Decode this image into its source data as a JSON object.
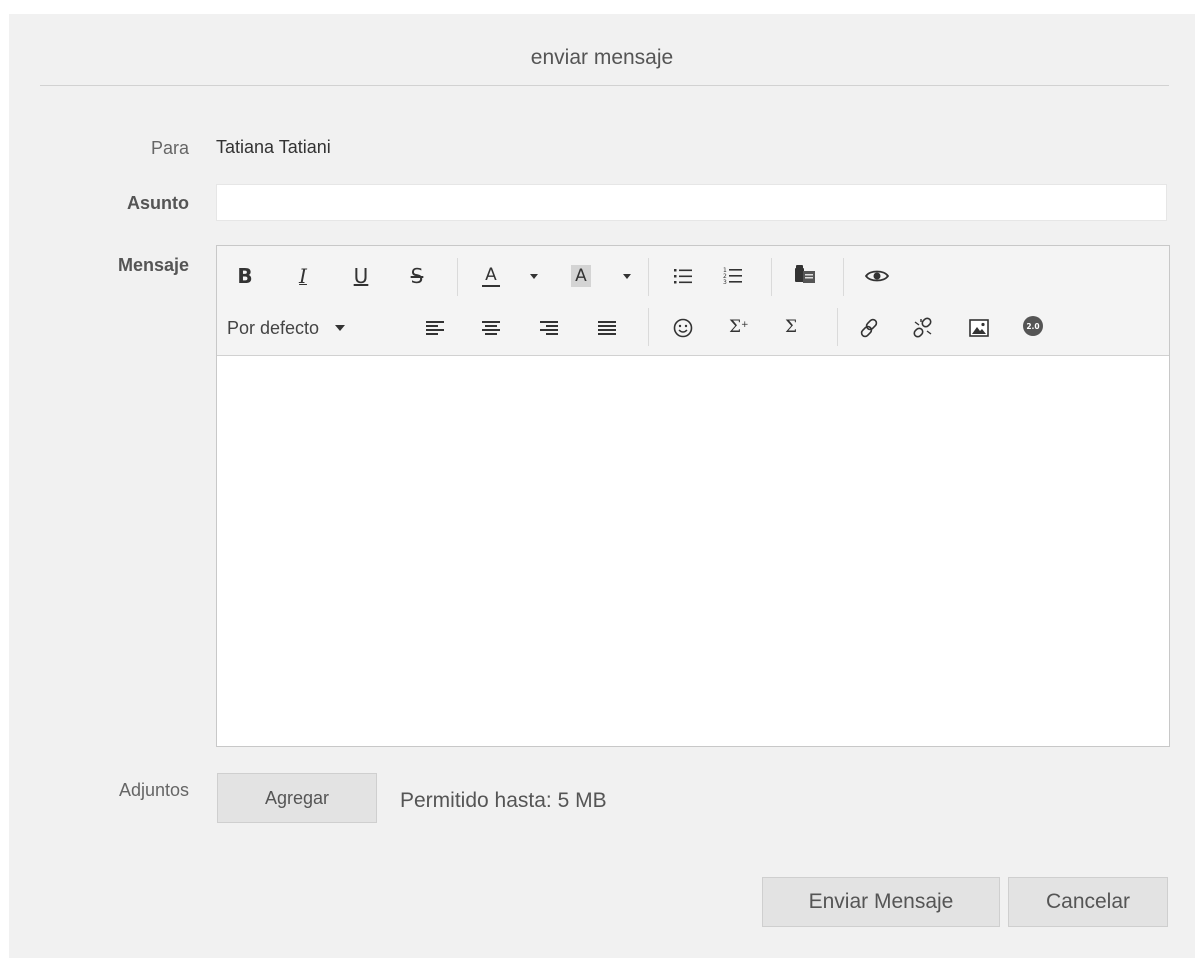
{
  "dialog": {
    "title": "enviar mensaje"
  },
  "form": {
    "to_label": "Para",
    "to_value": "Tatiana Tatiani",
    "subject_label": "Asunto",
    "subject_value": "",
    "message_label": "Mensaje",
    "attachments_label": "Adjuntos"
  },
  "toolbar": {
    "row1": [
      {
        "name": "bold-icon",
        "glyph": "B"
      },
      {
        "name": "italic-icon",
        "glyph": "I"
      },
      {
        "name": "underline-icon",
        "glyph": "U"
      },
      {
        "name": "strikethrough-icon",
        "glyph": "S"
      },
      {
        "name": "text-color-icon",
        "glyph": "A"
      },
      {
        "name": "background-color-icon",
        "glyph": "A"
      },
      {
        "name": "bulleted-list-icon"
      },
      {
        "name": "numbered-list-icon"
      },
      {
        "name": "paste-from-word-icon"
      },
      {
        "name": "preview-icon"
      }
    ],
    "row2": [
      {
        "name": "align-left-icon"
      },
      {
        "name": "align-center-icon"
      },
      {
        "name": "align-right-icon"
      },
      {
        "name": "justify-icon"
      },
      {
        "name": "emoji-icon"
      },
      {
        "name": "sum-plus-icon"
      },
      {
        "name": "sigma-icon"
      },
      {
        "name": "link-icon"
      },
      {
        "name": "unlink-icon"
      },
      {
        "name": "image-icon"
      },
      {
        "name": "web20-badge-icon"
      }
    ],
    "font_size_value": "Por defecto",
    "web20_badge_text": "2.0"
  },
  "attachments": {
    "add_label": "Agregar",
    "limit_text": "Permitido hasta: 5 MB"
  },
  "actions": {
    "send_label": "Enviar Mensaje",
    "cancel_label": "Cancelar"
  },
  "colors": {
    "dialog_background": "#f1f1f1",
    "button_background": "#e3e3e3",
    "toolbar_background": "#f4f4f4"
  }
}
